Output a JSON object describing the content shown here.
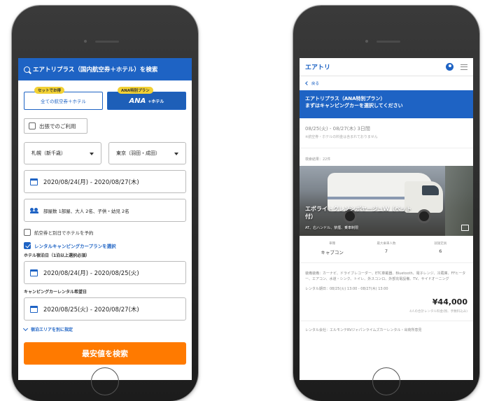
{
  "left": {
    "search_bar_label": "エアトリプラス（国内航空券＋ホテル）を検索",
    "tab_standard": {
      "badge": "セットでお得",
      "label": "全ての航空券＋ホテル"
    },
    "tab_ana": {
      "badge": "ANA特別プラン",
      "logo": "ANA",
      "label": "+ホテル"
    },
    "business_trip_label": "出張でのご利用",
    "origin": "札幌（新千歳）",
    "destination": "東京（羽田・成田）",
    "date_range": "2020/08/24(月) - 2020/08/27(木)",
    "guests": "部屋数 1部屋、大人 2名、子供・幼児 2名",
    "hotel_other_day_label": "航空券と別日でホテルを予約",
    "rental_camping_label": "レンタルキャンピングカープランを選択",
    "hotel_dates_label": "ホテル宿泊日（1泊以上選択必須）",
    "hotel_dates": "2020/08/24(月) - 2020/08/25(火)",
    "camper_dates_label": "キャンピングカーレンタル希望日",
    "camper_dates": "2020/08/25(火) - 2020/08/27(木)",
    "area_link": "宿泊エリアを別に指定",
    "search_button": "最安値を検索"
  },
  "right": {
    "logo": "エアトリ",
    "back_label": "戻る",
    "banner_line1": "エアトリプラス（ANA特別プラン）",
    "banner_line2": "まずはキャンピングカーを選択してください",
    "trip_dates": "08/25(火) - 08/27(木) 3日間",
    "trip_note": "※航空券・ホテルの料金は含まれておりません",
    "result_count": "検索結果：22件",
    "vehicle_name_line1": "エボライトクレソンボヤージュW（ベット",
    "vehicle_name_line2": "付）",
    "vehicle_spec": "AT、右ハンドル、禁煙、乗車制限",
    "spec_headers": [
      "車種",
      "最大乗車人数",
      "就寝定員"
    ],
    "spec_values": [
      "キャブコン",
      "7",
      "6"
    ],
    "equipment": "装備装備：カーナビ、ドライブレコーダー、ETC車載器、Bluetooth、電子レンジ、冷蔵庫、FFヒーター、エアコン、水道・シンク、トイレ、外スコンロ、外部充電設備、TV、サイドオーニング",
    "rental_period": "レンタル期日：08/25(火) 13:00 - 08/27(木) 13:00",
    "price": "¥44,000",
    "price_note": "4人の合計レンタル料金(税、手数料込み)",
    "rental_company": "レンタル会社：エルモンテRVジャパンライムズカーレンタル・出荷所意見"
  },
  "colors": {
    "primary_blue": "#1e63c4",
    "search_orange": "#ff7a00",
    "badge_yellow": "#f2d133"
  }
}
